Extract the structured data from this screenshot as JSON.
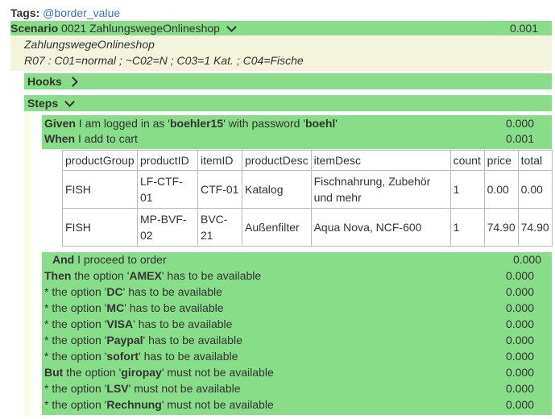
{
  "tags": {
    "label": "Tags:",
    "value": "@border_value"
  },
  "scenario": {
    "keyword": "Scenario",
    "title": "0021 ZahlungswegeOnlineshop",
    "duration": "0.001",
    "desc_line1": "ZahlungswegeOnlineshop",
    "desc_line2": "R07 : C01=normal ; ~C02=N ; C03=1 Kat. ; C04=Fische"
  },
  "hooks": {
    "label": "Hooks"
  },
  "steps_section": {
    "label": "Steps"
  },
  "steps_top": [
    {
      "kw": "Given",
      "pre": " I am logged in as '",
      "b1": "boehler15",
      "mid": "' with password '",
      "b2": "boehl",
      "post": "'",
      "dur": "0.000"
    },
    {
      "kw": "When",
      "pre": " I add to cart",
      "dur": "0.001"
    }
  ],
  "table": {
    "headers": [
      "productGroup",
      "productID",
      "itemID",
      "productDesc",
      "itemDesc",
      "count",
      "price",
      "total"
    ],
    "rows": [
      [
        "FISH",
        "LF-CTF-01",
        "CTF-01",
        "Katalog",
        "Fischnahrung, Zubehör und mehr",
        "1",
        "0.00",
        "0.00"
      ],
      [
        "FISH",
        "MP-BVF-02",
        "BVC-21",
        "Außenfilter",
        "Aqua Nova, NCF-600",
        "1",
        "74.90",
        "74.90"
      ]
    ]
  },
  "steps_bottom": [
    {
      "kw": "And",
      "pre": " I proceed to order",
      "opt": "",
      "post": "",
      "dur": "0.000"
    },
    {
      "kw": "Then",
      "pre": " the option '",
      "opt": "AMEX",
      "post": "' has to be available",
      "dur": "0.000"
    },
    {
      "kw": "*",
      "pre": " the option '",
      "opt": "DC",
      "post": "' has to be available",
      "dur": "0.000"
    },
    {
      "kw": "*",
      "pre": " the option '",
      "opt": "MC",
      "post": "' has to be available",
      "dur": "0.000"
    },
    {
      "kw": "*",
      "pre": " the option '",
      "opt": "VISA",
      "post": "' has to be available",
      "dur": "0.000"
    },
    {
      "kw": "*",
      "pre": " the option '",
      "opt": "Paypal",
      "post": "' has to be available",
      "dur": "0.000"
    },
    {
      "kw": "*",
      "pre": " the option '",
      "opt": "sofort",
      "post": "' has to be available",
      "dur": "0.000"
    },
    {
      "kw": "But",
      "pre": " the option '",
      "opt": "giropay",
      "post": "' must not be available",
      "dur": "0.000"
    },
    {
      "kw": "*",
      "pre": " the option '",
      "opt": "LSV",
      "post": "' must not be available",
      "dur": "0.000"
    },
    {
      "kw": "*",
      "pre": " the option '",
      "opt": "Rechnung",
      "post": "' must not be available",
      "dur": "0.000"
    }
  ]
}
